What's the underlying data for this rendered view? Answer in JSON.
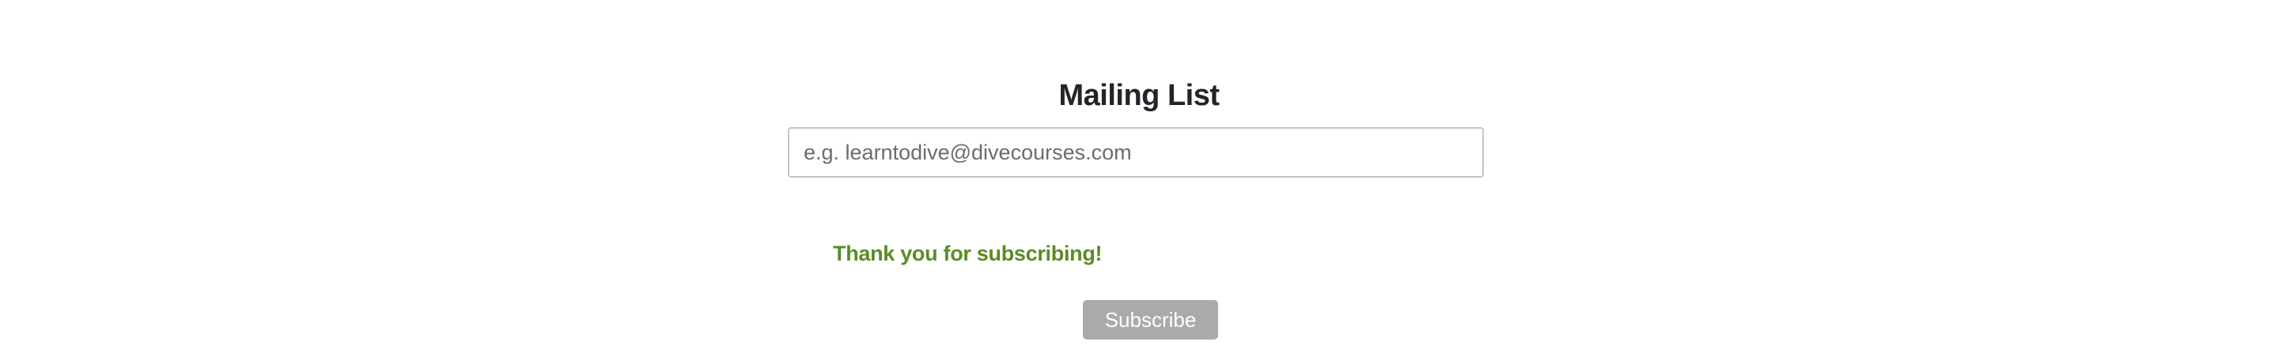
{
  "mailing_list": {
    "title": "Mailing List",
    "email_input": {
      "value": "",
      "placeholder": "e.g. learntodive@divecourses.com"
    },
    "success_message": "Thank you for subscribing!",
    "subscribe_label": "Subscribe"
  },
  "colors": {
    "title": "#212529",
    "success": "#5b8c25",
    "button_bg": "#aaaaaa",
    "button_text": "#ffffff"
  }
}
